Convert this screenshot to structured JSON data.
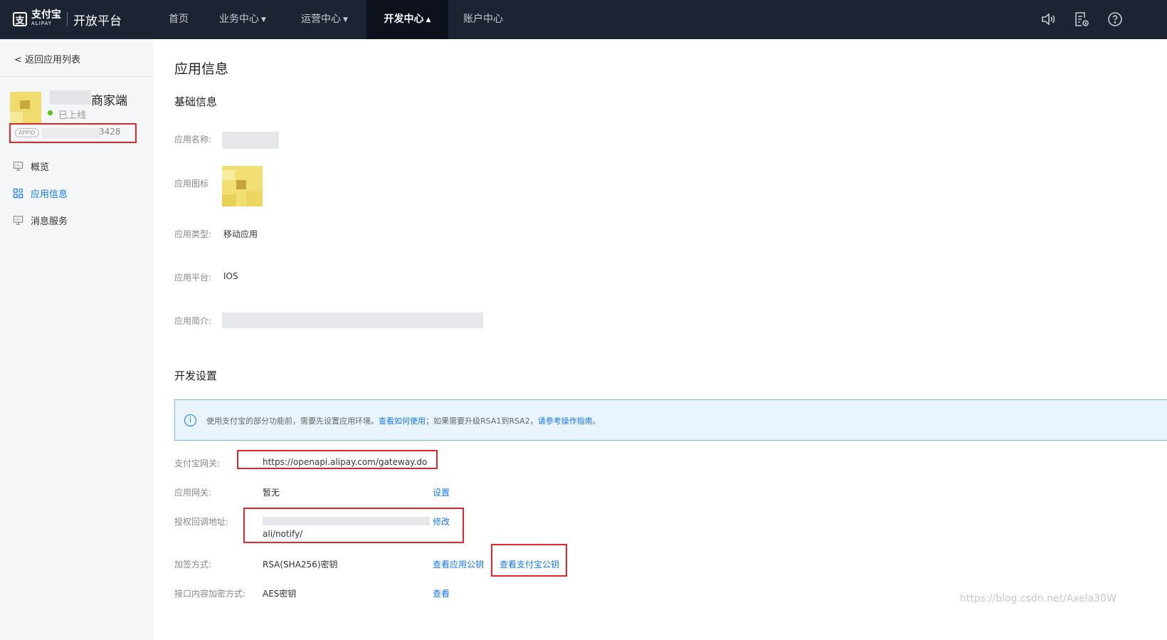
{
  "header": {
    "logo_cn": "支付宝",
    "logo_en": "ALIPAY",
    "platform_title": "开放平台",
    "nav": [
      {
        "label": "首页"
      },
      {
        "label": "业务中心"
      },
      {
        "label": "运营中心"
      },
      {
        "label": "开发中心"
      },
      {
        "label": "账户中心"
      }
    ],
    "active_nav": "开发中心",
    "icons": [
      "speaker-icon",
      "document-settings-icon",
      "help-icon"
    ]
  },
  "sidebar": {
    "back_label": "返回应用列表",
    "app_name_suffix": "商家端",
    "status": "已上线",
    "appid_tag": "APPID",
    "appid_visible_suffix": "3428",
    "items": [
      {
        "label": "概览",
        "icon": "overview-icon"
      },
      {
        "label": "应用信息",
        "icon": "app-grid-icon"
      },
      {
        "label": "消息服务",
        "icon": "message-icon"
      }
    ],
    "active_item": "应用信息"
  },
  "main": {
    "title": "应用信息",
    "basic_section": "基础信息",
    "fields": {
      "name_label": "应用名称:",
      "icon_label": "应用图标",
      "type_label": "应用类型:",
      "type_value": "移动应用",
      "platform_label": "应用平台:",
      "platform_value": "IOS",
      "intro_label": "应用简介:"
    },
    "dev_section": "开发设置",
    "notice": {
      "text_1": "使用支付宝的部分功能前，需要先设置应用环境。",
      "link_1": "查看如何使用",
      "text_2": "；如果需要升级RSA1到RSA2，",
      "link_2": "请参考操作指南",
      "text_3": "。"
    },
    "dev": {
      "gateway_label": "支付宝网关:",
      "gateway_value": "https://openapi.alipay.com/gateway.do",
      "app_gateway_label": "应用网关:",
      "app_gateway_value": "暂无",
      "app_gateway_action": "设置",
      "callback_label": "授权回调地址:",
      "callback_value_tail": "ali/notify/",
      "callback_action": "修改",
      "sign_label": "加签方式:",
      "sign_value": "RSA(SHA256)密钥",
      "sign_action_1": "查看应用公钥",
      "sign_action_2": "查看支付宝公钥",
      "encrypt_label": "接口内容加密方式:",
      "encrypt_value": "AES密钥",
      "encrypt_action": "查看"
    }
  },
  "watermark": "https://blog.csdn.net/Axela30W",
  "colors": {
    "accent": "#1677ff",
    "topbar": "#1c2333",
    "highlight_box": "#e4262b",
    "online": "#52c41a"
  }
}
